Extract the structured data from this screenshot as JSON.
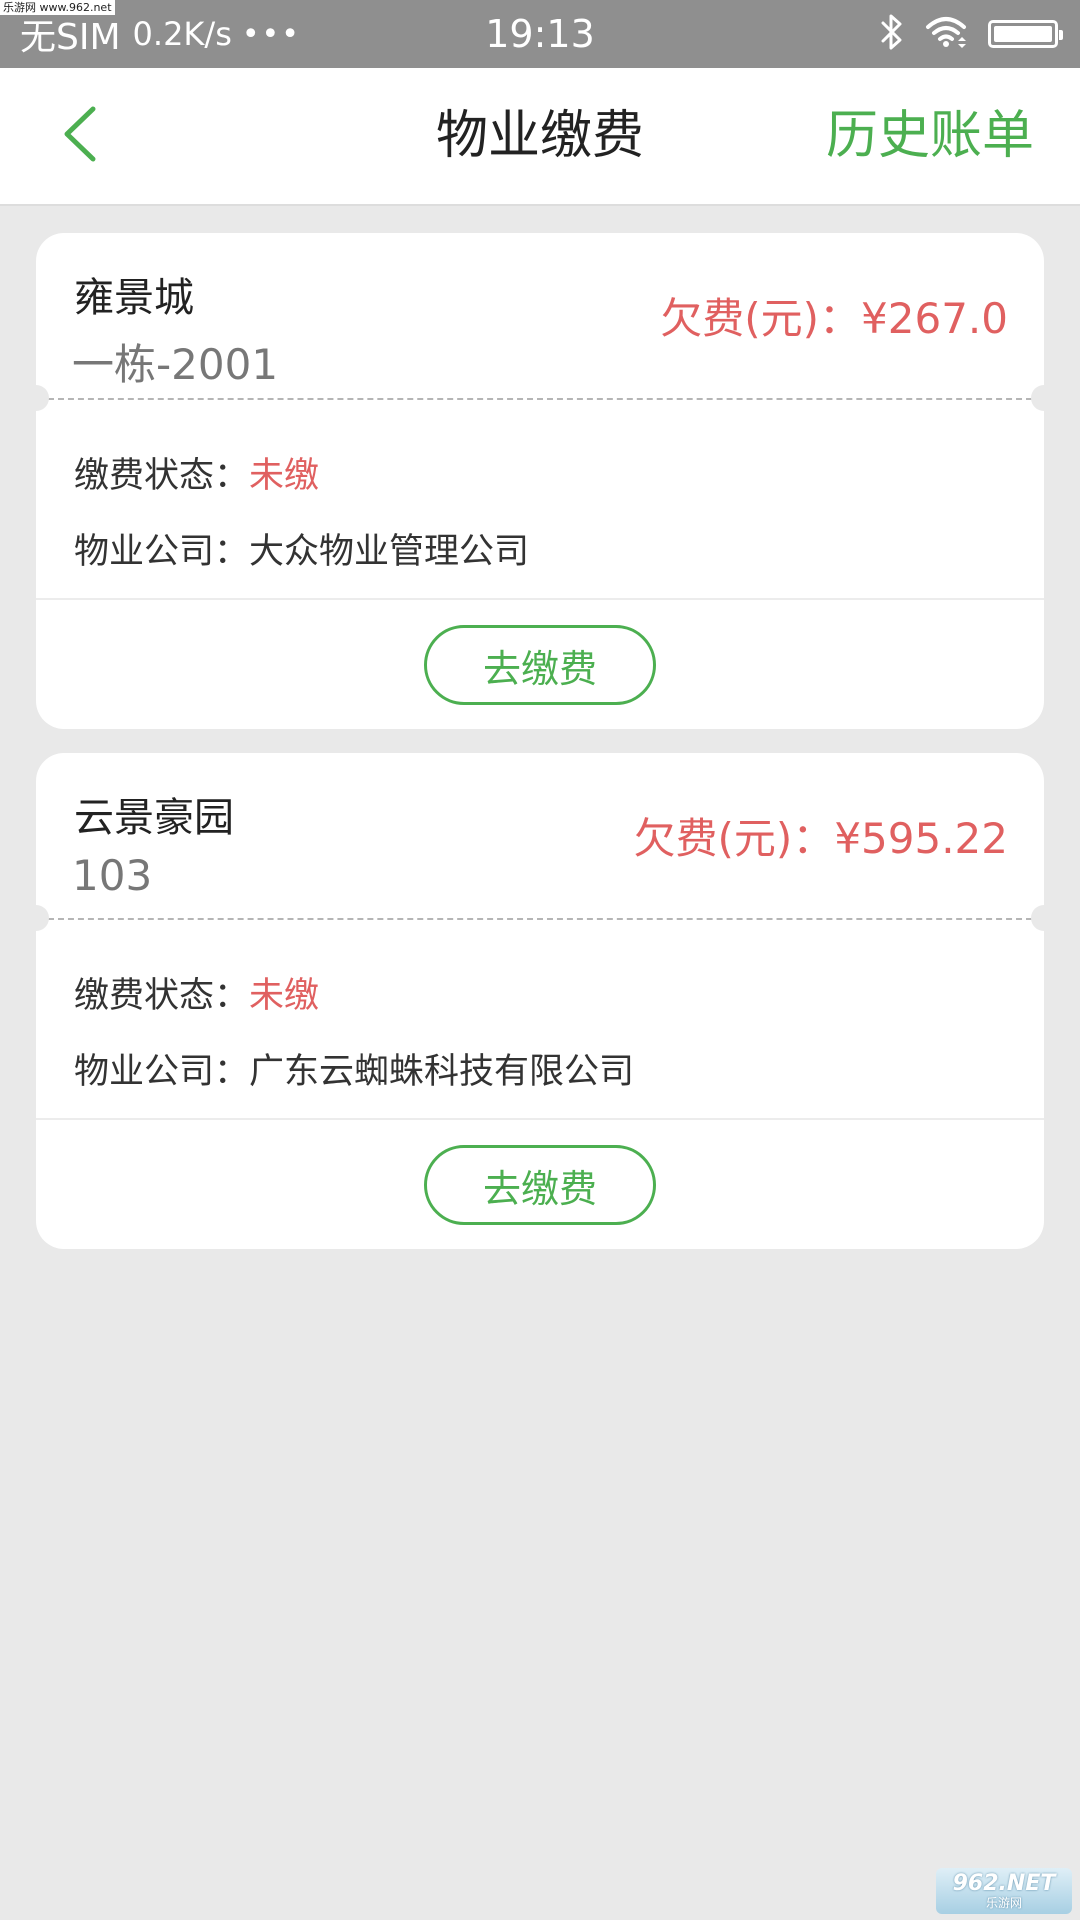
{
  "status_bar": {
    "carrier": "无SIM",
    "speed": "0.2K/s",
    "dots": "•••",
    "time": "19:13",
    "icons": [
      "bluetooth-icon",
      "wifi-icon",
      "battery-icon"
    ],
    "battery_level": 1.0
  },
  "watermark": {
    "top_left": "乐游网 www.962.net",
    "bottom_right_main": "962.NET",
    "bottom_right_sub": "乐游网"
  },
  "nav": {
    "back_icon": "chevron-left-icon",
    "title": "物业缴费",
    "right_action": "历史账单"
  },
  "colors": {
    "accent_green": "#4caf50",
    "owed_red": "#e06060",
    "background": "#e9e9e9"
  },
  "cards": [
    {
      "name": "雍景城",
      "unit": "一栋-2001",
      "owed_text": "欠费(元)：¥267.0",
      "status_label": "缴费状态：",
      "status_value": "未缴",
      "company_label": "物业公司：",
      "company_value": "大众物业管理公司",
      "pay_label": "去缴费"
    },
    {
      "name": "云景豪园",
      "unit": "103",
      "owed_text": "欠费(元)：¥595.22",
      "status_label": "缴费状态：",
      "status_value": "未缴",
      "company_label": "物业公司：",
      "company_value": "广东云蜘蛛科技有限公司",
      "pay_label": "去缴费"
    }
  ]
}
